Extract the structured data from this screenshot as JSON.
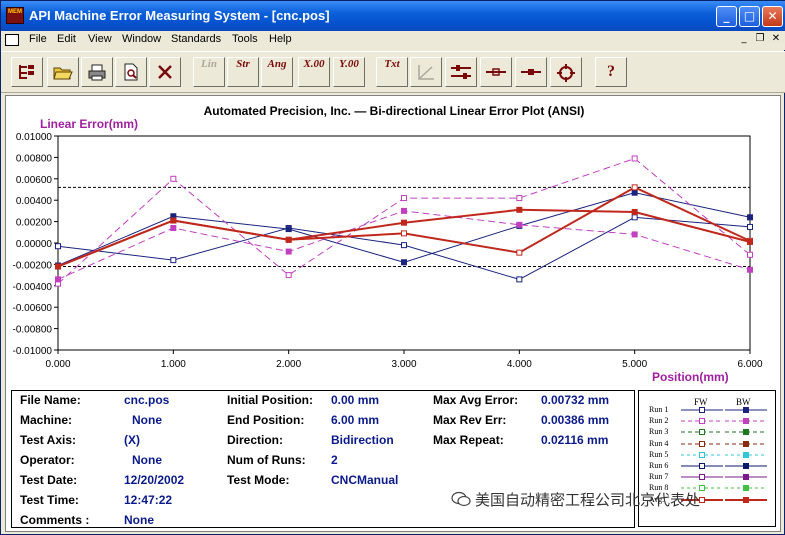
{
  "window": {
    "title": "API Machine Error Measuring System - [cnc.pos]",
    "icon_text": "MEM",
    "min_glyph": "_",
    "max_glyph": "□",
    "close_glyph": "✕"
  },
  "menu": [
    "File",
    "Edit",
    "View",
    "Window",
    "Standards",
    "Tools",
    "Help"
  ],
  "toolbar": {
    "lin": "Lin",
    "str": "Str",
    "ang": "Ang",
    "x00": "X.00",
    "y00": "Y.00",
    "txt": "Txt",
    "help": "?"
  },
  "chart_data": {
    "type": "line",
    "title": "Automated Precision, Inc. — Bi-directional Linear Error Plot   (ANSI)",
    "ylabel": "Linear Error(mm)",
    "xlabel": "Position(mm)",
    "x": [
      0,
      1,
      2,
      3,
      4,
      5,
      6
    ],
    "xlim": [
      0,
      6
    ],
    "ylim": [
      -0.01,
      0.01
    ],
    "ytick_step": 0.002,
    "x_tick_labels": [
      "0.000",
      "1.000",
      "2.000",
      "3.000",
      "4.000",
      "5.000",
      "6.000"
    ],
    "y_tick_labels": [
      "0.01000",
      "0.00800",
      "0.00600",
      "0.00400",
      "0.00200",
      "0.00000",
      "-0.00200",
      "-0.00400",
      "-0.00600",
      "-0.00800",
      "-0.01000"
    ],
    "limit_lines": [
      0.0052,
      -0.0022
    ],
    "series": [
      {
        "name": "Run 1 FW",
        "color": "#1a237e",
        "dash": "",
        "marker": "open",
        "values": [
          -0.0003,
          -0.0016,
          0.0014,
          -0.0002,
          -0.0034,
          0.0024,
          0.0015
        ]
      },
      {
        "name": "Run 1 BW",
        "color": "#1a237e",
        "dash": "",
        "marker": "filled",
        "values": [
          -0.0021,
          0.0025,
          0.0013,
          -0.0018,
          0.0016,
          0.0047,
          0.0024
        ]
      },
      {
        "name": "Run 2 FW",
        "color": "#c040c0",
        "dash": "7,4",
        "marker": "open",
        "values": [
          -0.0038,
          0.006,
          -0.003,
          0.0042,
          0.0042,
          0.0079,
          -0.0011
        ]
      },
      {
        "name": "Run 2 BW",
        "color": "#c040c0",
        "dash": "7,4",
        "marker": "filled",
        "values": [
          -0.0034,
          0.0014,
          -0.0008,
          0.003,
          0.0017,
          0.0008,
          -0.0025
        ]
      },
      {
        "name": "Avg. FW",
        "color": "#c0281c",
        "dash": "",
        "marker": "open",
        "width": 2,
        "values": [
          -0.0022,
          0.0021,
          0.0003,
          0.0009,
          -0.0009,
          0.0052,
          0.0002
        ]
      },
      {
        "name": "Avg. BW",
        "color": "#c0281c",
        "dash": "",
        "marker": "filled",
        "width": 2,
        "values": [
          -0.0022,
          0.0021,
          0.0003,
          0.0019,
          0.0031,
          0.0029,
          0.0001
        ]
      }
    ]
  },
  "info": {
    "file_name_label": "File Name:",
    "file_name": "cnc.pos",
    "machine_label": "Machine:",
    "machine": "None",
    "test_axis_label": "Test Axis:",
    "test_axis": "(X)",
    "operator_label": "Operator:",
    "operator": "None",
    "test_date_label": "Test Date:",
    "test_date": "12/20/2002",
    "test_time_label": "Test Time:",
    "test_time": "12:47:22",
    "comments_label": "Comments :",
    "comments": "None",
    "initial_position_label": "Initial Position:",
    "initial_position": "0.00 mm",
    "end_position_label": "End Position:",
    "end_position": "6.00 mm",
    "direction_label": "Direction:",
    "direction": "Bidirection",
    "num_runs_label": "Num of Runs:",
    "num_runs": "2",
    "test_mode_label": "Test Mode:",
    "test_mode": "CNCManual",
    "max_avg_error_label": "Max Avg Error:",
    "max_avg_error": "0.00732 mm",
    "max_rev_err_label": "Max Rev Err:",
    "max_rev_err": "0.00386 mm",
    "max_repeat_label": "Max Repeat:",
    "max_repeat": "0.02116 mm"
  },
  "legend": {
    "fw": "FW",
    "bw": "BW",
    "rows": [
      {
        "name": "Run 1",
        "color": "#1a237e",
        "dash": ""
      },
      {
        "name": "Run 2",
        "color": "#c040c0",
        "dash": "4,3"
      },
      {
        "name": "Run 3",
        "color": "#1e7a1e",
        "dash": "4,3"
      },
      {
        "name": "Run 4",
        "color": "#8a2a10",
        "dash": "4,3"
      },
      {
        "name": "Run 5",
        "color": "#30c8d8",
        "dash": "3,3"
      },
      {
        "name": "Run 6",
        "color": "#0a1a6a",
        "dash": ""
      },
      {
        "name": "Run 7",
        "color": "#7a1a8a",
        "dash": ""
      },
      {
        "name": "Run 8",
        "color": "#40c040",
        "dash": "3,3"
      },
      {
        "name": "Avg.",
        "color": "#c0281c",
        "dash": ""
      }
    ]
  },
  "watermark": "美国自动精密工程公司北京代表处"
}
